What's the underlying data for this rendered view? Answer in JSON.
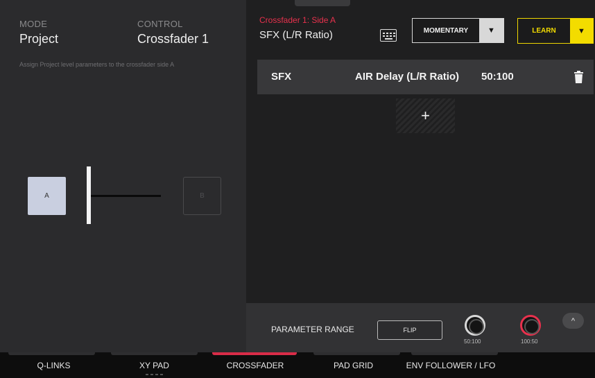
{
  "mode": {
    "caption": "MODE",
    "value": "Project"
  },
  "control": {
    "caption": "CONTROL",
    "value": "Crossfader 1"
  },
  "description": "Assign Project level parameters to the crossfader side A",
  "crossfader": {
    "side_a_label": "A",
    "side_b_label": "B"
  },
  "assignment": {
    "title": "Crossfader 1: Side A",
    "parameter": "SFX (L/R Ratio)",
    "keyboard_icon": "keyboard-icon"
  },
  "mode_select": {
    "label": "MOMENTARY",
    "arrow": "▼"
  },
  "learn": {
    "label": "LEARN",
    "arrow": "▼"
  },
  "assignments": [
    {
      "target": "SFX",
      "parameter": "AIR Delay (L/R Ratio)",
      "value": "50:100",
      "delete_icon": "trash-icon"
    }
  ],
  "add_slot": {
    "icon": "+"
  },
  "parameter_range": {
    "label": "PARAMETER RANGE",
    "flip_label": "FLIP",
    "min_value": "50:100",
    "max_value": "100:50",
    "collapse_icon": "^"
  },
  "tabs": [
    {
      "label": "Q-LINKS",
      "active": false
    },
    {
      "label": "XY PAD",
      "active": false
    },
    {
      "label": "CROSSFADER",
      "active": true
    },
    {
      "label": "PAD GRID",
      "active": false
    },
    {
      "label": "ENV FOLLOWER / LFO",
      "active": false
    }
  ],
  "colors": {
    "accent_red": "#e8314d",
    "learn_yellow": "#f3dc00",
    "panel_left": "#2b2b2d",
    "panel_right": "#1f1f20"
  }
}
